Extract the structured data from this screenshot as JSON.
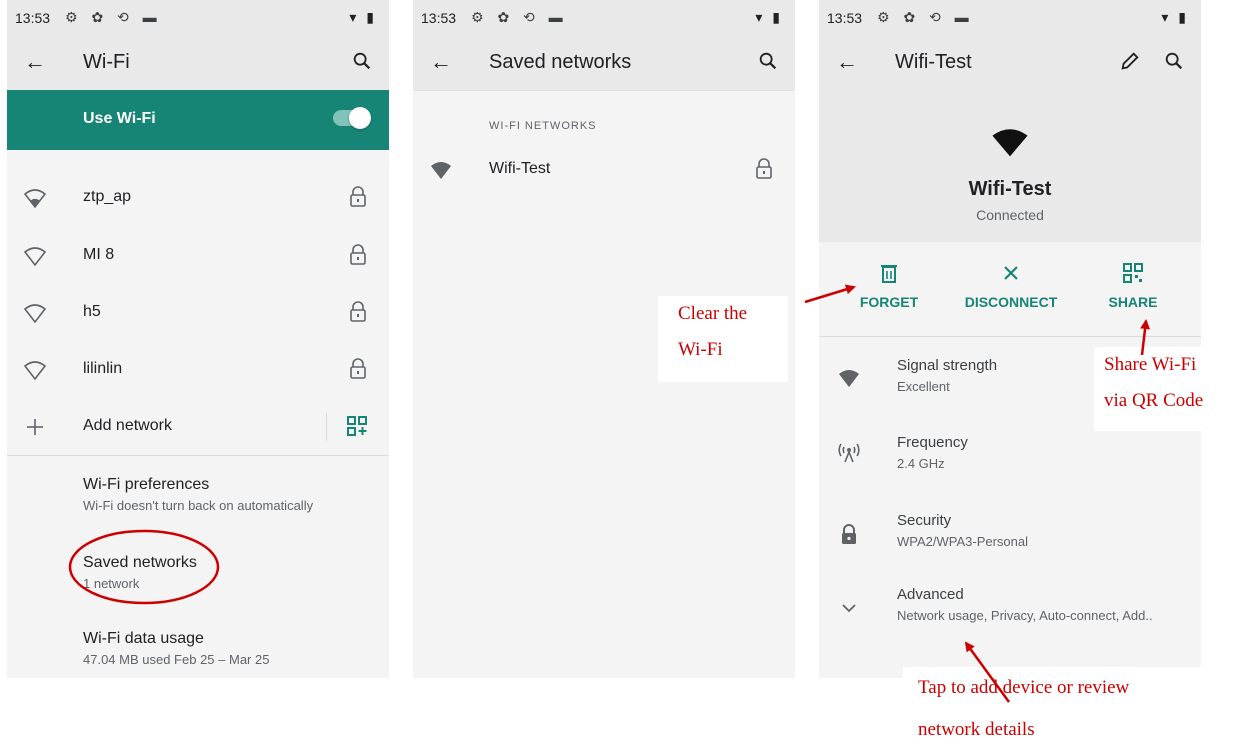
{
  "status": {
    "time": "13:53",
    "icons": "⚙ ✿ ⟲ ▬",
    "right": "▾ ▮"
  },
  "screen1": {
    "title": "Wi-Fi",
    "use_wifi": "Use Wi-Fi",
    "networks": [
      {
        "name": "ztp_ap"
      },
      {
        "name": "MI 8"
      },
      {
        "name": "h5"
      },
      {
        "name": "lilinlin"
      }
    ],
    "add_network": "Add network",
    "prefs_title": "Wi-Fi preferences",
    "prefs_sub": "Wi-Fi doesn't turn back on automatically",
    "saved_title": "Saved networks",
    "saved_sub": "1 network",
    "usage_title": "Wi-Fi data usage",
    "usage_sub": "47.04 MB used Feb 25 – Mar 25"
  },
  "screen2": {
    "title": "Saved networks",
    "section": "WI-FI NETWORKS",
    "network": "Wifi-Test"
  },
  "screen3": {
    "title": "Wifi-Test",
    "network_name": "Wifi-Test",
    "status": "Connected",
    "actions": {
      "forget": "FORGET",
      "disconnect": "DISCONNECT",
      "share": "SHARE"
    },
    "details": [
      {
        "title": "Signal strength",
        "sub": "Excellent"
      },
      {
        "title": "Frequency",
        "sub": "2.4 GHz"
      },
      {
        "title": "Security",
        "sub": "WPA2/WPA3-Personal"
      },
      {
        "title": "Advanced",
        "sub": "Network usage, Privacy, Auto-connect, Add.."
      }
    ]
  },
  "callouts": {
    "clear_line1": "Clear the",
    "clear_line2": "Wi-Fi",
    "share_line1": "Share Wi-Fi",
    "share_line2": "via QR Code",
    "tap_line1": "Tap to add device or review",
    "tap_line2": "network details"
  },
  "colors": {
    "accent": "#168576",
    "annotation": "#cc0000",
    "bar": "#e9e9e9",
    "background": "#f4f4f4"
  }
}
